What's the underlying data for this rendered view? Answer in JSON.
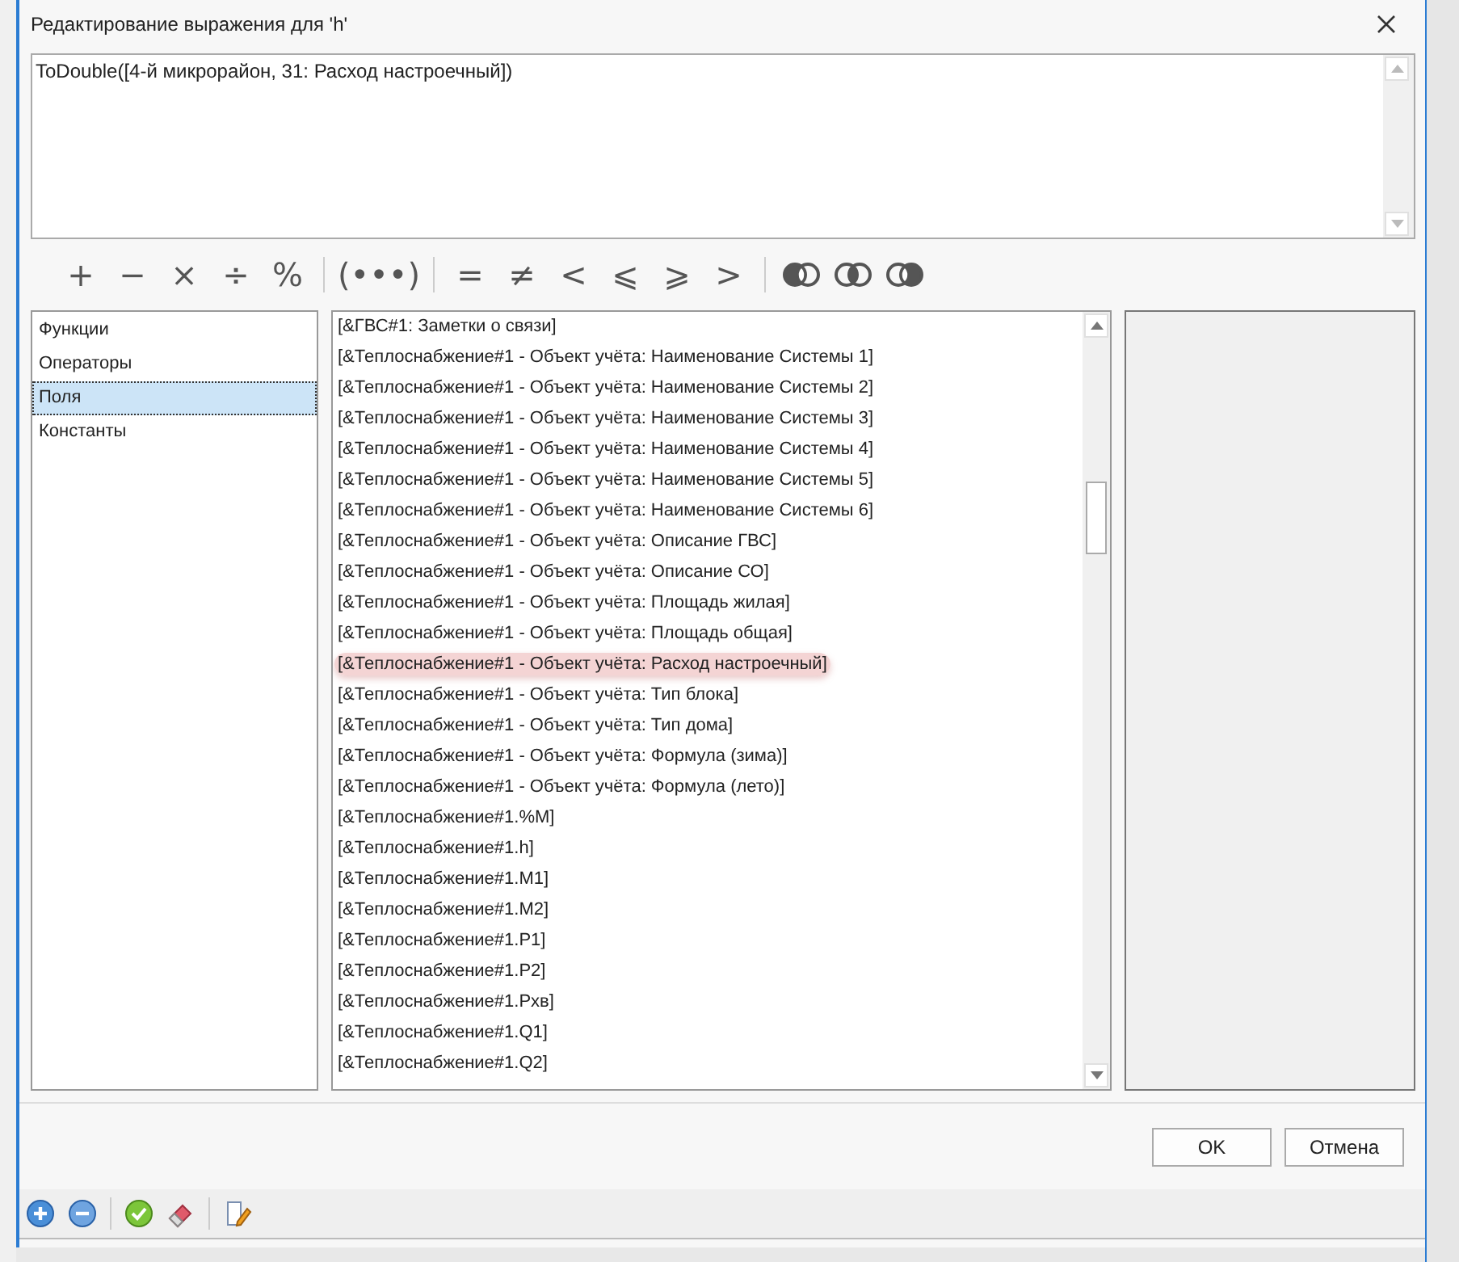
{
  "window": {
    "title": "Редактирование выражения для 'h'"
  },
  "expression": {
    "value": "ToDouble([4-й микрорайон, 31: Расход настроечный])"
  },
  "operators": [
    {
      "kind": "text",
      "label": "+"
    },
    {
      "kind": "text",
      "label": "−"
    },
    {
      "kind": "text",
      "label": "×"
    },
    {
      "kind": "text",
      "label": "÷"
    },
    {
      "kind": "text",
      "label": "%"
    },
    {
      "kind": "separator"
    },
    {
      "kind": "text",
      "label": "(•••)"
    },
    {
      "kind": "separator"
    },
    {
      "kind": "text",
      "label": "="
    },
    {
      "kind": "text",
      "label": "≠"
    },
    {
      "kind": "text",
      "label": "<"
    },
    {
      "kind": "text",
      "label": "⩽"
    },
    {
      "kind": "text",
      "label": "⩾"
    },
    {
      "kind": "text",
      "label": ">"
    },
    {
      "kind": "separator"
    },
    {
      "kind": "venn_left"
    },
    {
      "kind": "venn_middle"
    },
    {
      "kind": "venn_right"
    }
  ],
  "categories": [
    {
      "label": "Функции",
      "selected": false
    },
    {
      "label": "Операторы",
      "selected": false
    },
    {
      "label": "Поля",
      "selected": true
    },
    {
      "label": "Константы",
      "selected": false
    }
  ],
  "fields": [
    {
      "label": "[&ГВС#1: Заметки о связи]",
      "highlighted": false
    },
    {
      "label": "[&Теплоснабжение#1 - Объект учёта: Наименование Системы 1]",
      "highlighted": false
    },
    {
      "label": "[&Теплоснабжение#1 - Объект учёта: Наименование Системы 2]",
      "highlighted": false
    },
    {
      "label": "[&Теплоснабжение#1 - Объект учёта: Наименование Системы 3]",
      "highlighted": false
    },
    {
      "label": "[&Теплоснабжение#1 - Объект учёта: Наименование Системы 4]",
      "highlighted": false
    },
    {
      "label": "[&Теплоснабжение#1 - Объект учёта: Наименование Системы 5]",
      "highlighted": false
    },
    {
      "label": "[&Теплоснабжение#1 - Объект учёта: Наименование Системы 6]",
      "highlighted": false
    },
    {
      "label": "[&Теплоснабжение#1 - Объект учёта: Описание ГВС]",
      "highlighted": false
    },
    {
      "label": "[&Теплоснабжение#1 - Объект учёта: Описание СО]",
      "highlighted": false
    },
    {
      "label": "[&Теплоснабжение#1 - Объект учёта: Площадь жилая]",
      "highlighted": false
    },
    {
      "label": "[&Теплоснабжение#1 - Объект учёта: Площадь общая]",
      "highlighted": false
    },
    {
      "label": "[&Теплоснабжение#1 - Объект учёта: Расход настроечный]",
      "highlighted": true
    },
    {
      "label": "[&Теплоснабжение#1 - Объект учёта: Тип блока]",
      "highlighted": false
    },
    {
      "label": "[&Теплоснабжение#1 - Объект учёта: Тип дома]",
      "highlighted": false
    },
    {
      "label": "[&Теплоснабжение#1 - Объект учёта: Формула (зима)]",
      "highlighted": false
    },
    {
      "label": "[&Теплоснабжение#1 - Объект учёта: Формула (лето)]",
      "highlighted": false
    },
    {
      "label": "[&Теплоснабжение#1.%M]",
      "highlighted": false
    },
    {
      "label": "[&Теплоснабжение#1.h]",
      "highlighted": false
    },
    {
      "label": "[&Теплоснабжение#1.M1]",
      "highlighted": false
    },
    {
      "label": "[&Теплоснабжение#1.M2]",
      "highlighted": false
    },
    {
      "label": "[&Теплоснабжение#1.P1]",
      "highlighted": false
    },
    {
      "label": "[&Теплоснабжение#1.P2]",
      "highlighted": false
    },
    {
      "label": "[&Теплоснабжение#1.Pхв]",
      "highlighted": false
    },
    {
      "label": "[&Теплоснабжение#1.Q1]",
      "highlighted": false
    },
    {
      "label": "[&Теплоснабжение#1.Q2]",
      "highlighted": false
    }
  ],
  "buttons": [
    {
      "label": "OK"
    },
    {
      "label": "Отмена"
    }
  ],
  "toolbar": [
    {
      "kind": "add"
    },
    {
      "kind": "remove"
    },
    {
      "kind": "separator"
    },
    {
      "kind": "check"
    },
    {
      "kind": "eraser"
    },
    {
      "kind": "separator"
    },
    {
      "kind": "edit"
    }
  ]
}
